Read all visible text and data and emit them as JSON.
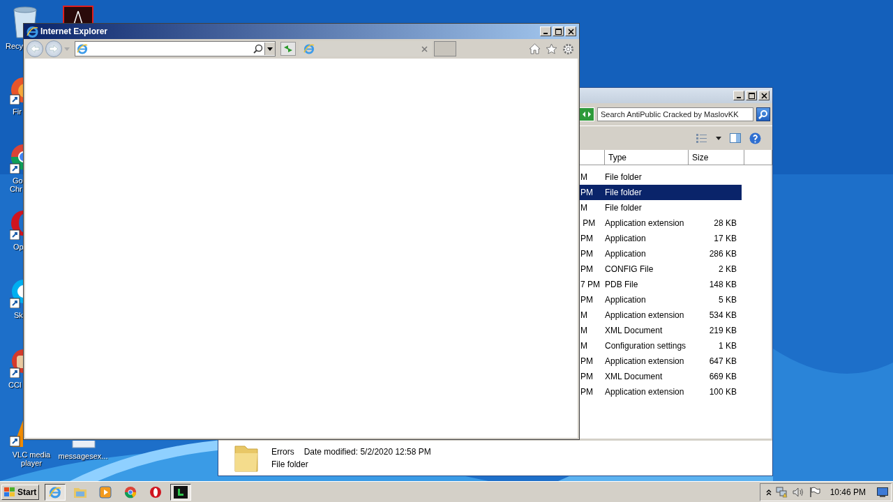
{
  "desktop_icons": [
    {
      "kind": "recycle-bin",
      "lines": [
        "Recy"
      ]
    },
    {
      "kind": "pdf"
    },
    {
      "kind": "firefox",
      "lines": [
        "Fir"
      ]
    },
    {
      "kind": "chrome",
      "lines": [
        "Go",
        "Chr"
      ]
    },
    {
      "kind": "opera",
      "lines": [
        "Op"
      ]
    },
    {
      "kind": "skype",
      "lines": [
        "Sk"
      ]
    },
    {
      "kind": "ccleaner",
      "lines": [
        "CCl"
      ]
    },
    {
      "kind": "vlc",
      "lines": [
        "VLC media",
        "player"
      ]
    },
    {
      "kind": "document",
      "lines": [
        "messagesex..."
      ]
    }
  ],
  "explorer": {
    "search_placeholder": "Search AntiPublic Cracked by MaslovKK",
    "columns": [
      "Type",
      "Size"
    ],
    "rows": [
      {
        "date": "M",
        "type": "File folder",
        "size": "",
        "selected": false
      },
      {
        "date": "PM",
        "type": "File folder",
        "size": "",
        "selected": true
      },
      {
        "date": "M",
        "type": "File folder",
        "size": "",
        "selected": false
      },
      {
        "date": " PM",
        "type": "Application extension",
        "size": "28 KB",
        "selected": false
      },
      {
        "date": "PM",
        "type": "Application",
        "size": "17 KB",
        "selected": false
      },
      {
        "date": "PM",
        "type": "Application",
        "size": "286 KB",
        "selected": false
      },
      {
        "date": "PM",
        "type": "CONFIG File",
        "size": "2 KB",
        "selected": false
      },
      {
        "date": "7 PM",
        "type": "PDB File",
        "size": "148 KB",
        "selected": false
      },
      {
        "date": "PM",
        "type": "Application",
        "size": "5 KB",
        "selected": false
      },
      {
        "date": "M",
        "type": "Application extension",
        "size": "534 KB",
        "selected": false
      },
      {
        "date": "M",
        "type": "XML Document",
        "size": "219 KB",
        "selected": false
      },
      {
        "date": "M",
        "type": "Configuration settings",
        "size": "1 KB",
        "selected": false
      },
      {
        "date": "PM",
        "type": "Application extension",
        "size": "647 KB",
        "selected": false
      },
      {
        "date": "PM",
        "type": "XML Document",
        "size": "669 KB",
        "selected": false
      },
      {
        "date": "PM",
        "type": "Application extension",
        "size": "100 KB",
        "selected": false
      }
    ],
    "details": {
      "name": "Errors",
      "modified": "Date modified: 5/2/2020 12:58 PM",
      "type": "File folder"
    }
  },
  "ie_window": {
    "title": "Internet Explorer"
  },
  "taskbar": {
    "start": "Start",
    "apps": [
      {
        "kind": "ie",
        "selected": true
      },
      {
        "kind": "folder",
        "selected": false
      },
      {
        "kind": "media",
        "selected": false
      },
      {
        "kind": "chrome",
        "selected": false
      },
      {
        "kind": "opera",
        "selected": false
      },
      {
        "kind": "terminal",
        "selected": true
      }
    ],
    "clock": "10:46 PM"
  }
}
